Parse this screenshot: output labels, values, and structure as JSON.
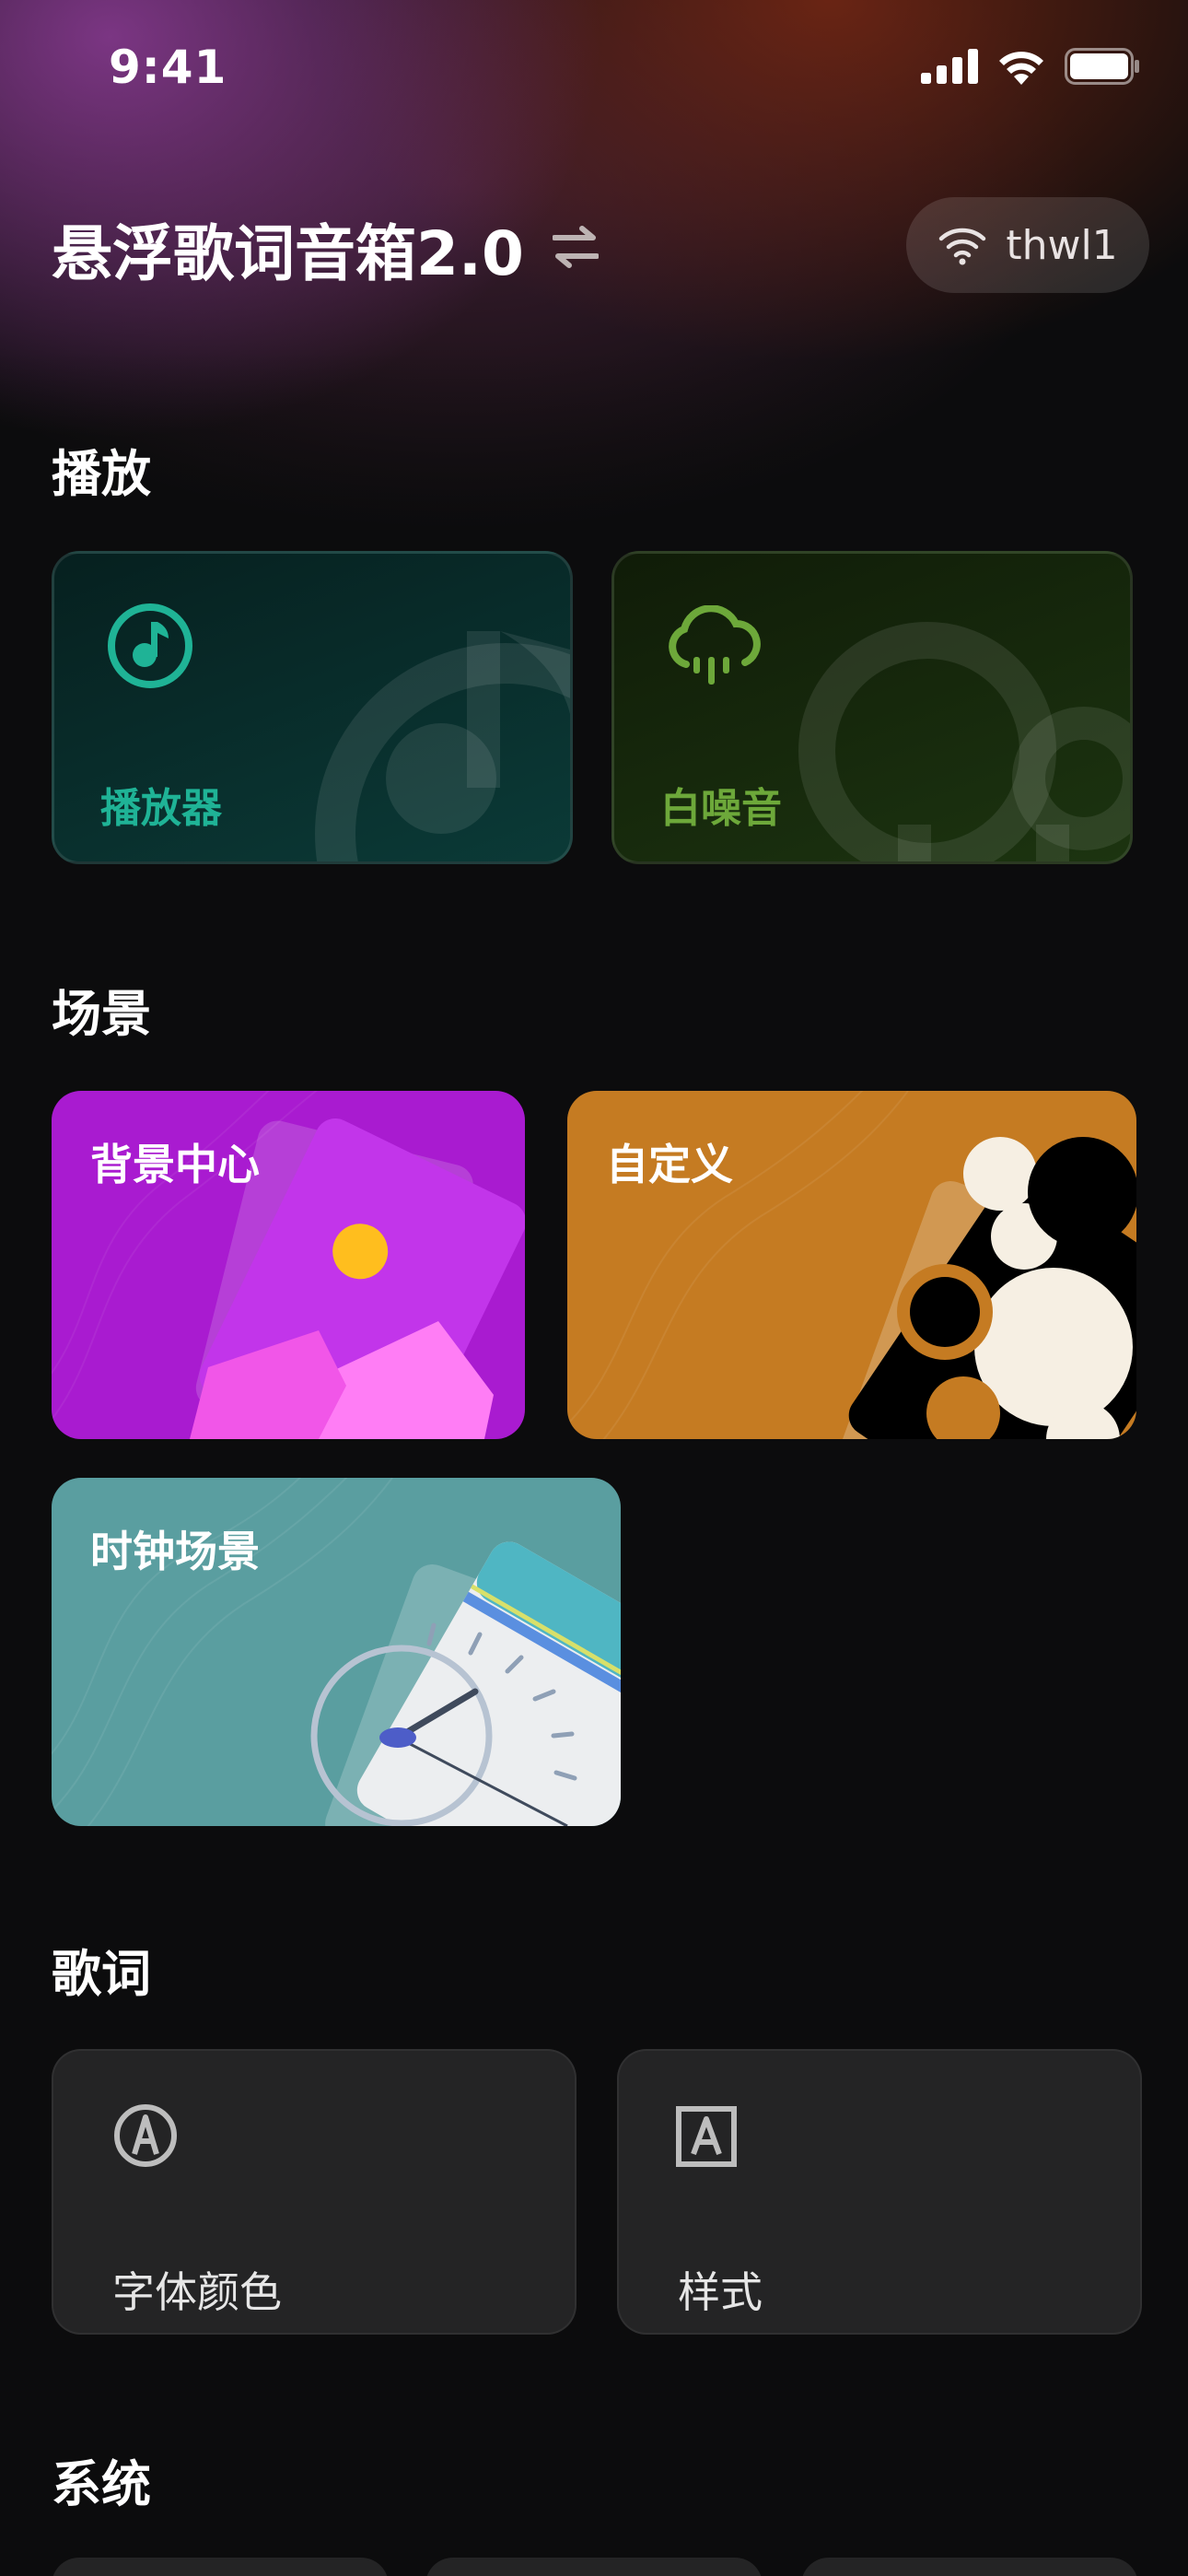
{
  "status_bar": {
    "time": "9:41"
  },
  "header": {
    "title": "悬浮歌词音箱2.0",
    "wifi_name": "thwl1"
  },
  "sections": {
    "play": "播放",
    "scene": "场景",
    "lyrics": "歌词",
    "system": "系统"
  },
  "play_cards": [
    {
      "label": "播放器",
      "icon": "music-note-icon",
      "color": "#1fb396"
    },
    {
      "label": "白噪音",
      "icon": "cloud-rain-icon",
      "color": "#6da83a"
    }
  ],
  "scene_cards": [
    {
      "label": "背景中心",
      "color": "#a91bd0"
    },
    {
      "label": "自定义",
      "color": "#c57b22"
    },
    {
      "label": "时钟场景",
      "color": "#5a9ea0"
    }
  ],
  "lyric_cards": [
    {
      "label": "字体颜色",
      "icon": "font-color-icon"
    },
    {
      "label": "样式",
      "icon": "text-style-icon"
    }
  ]
}
